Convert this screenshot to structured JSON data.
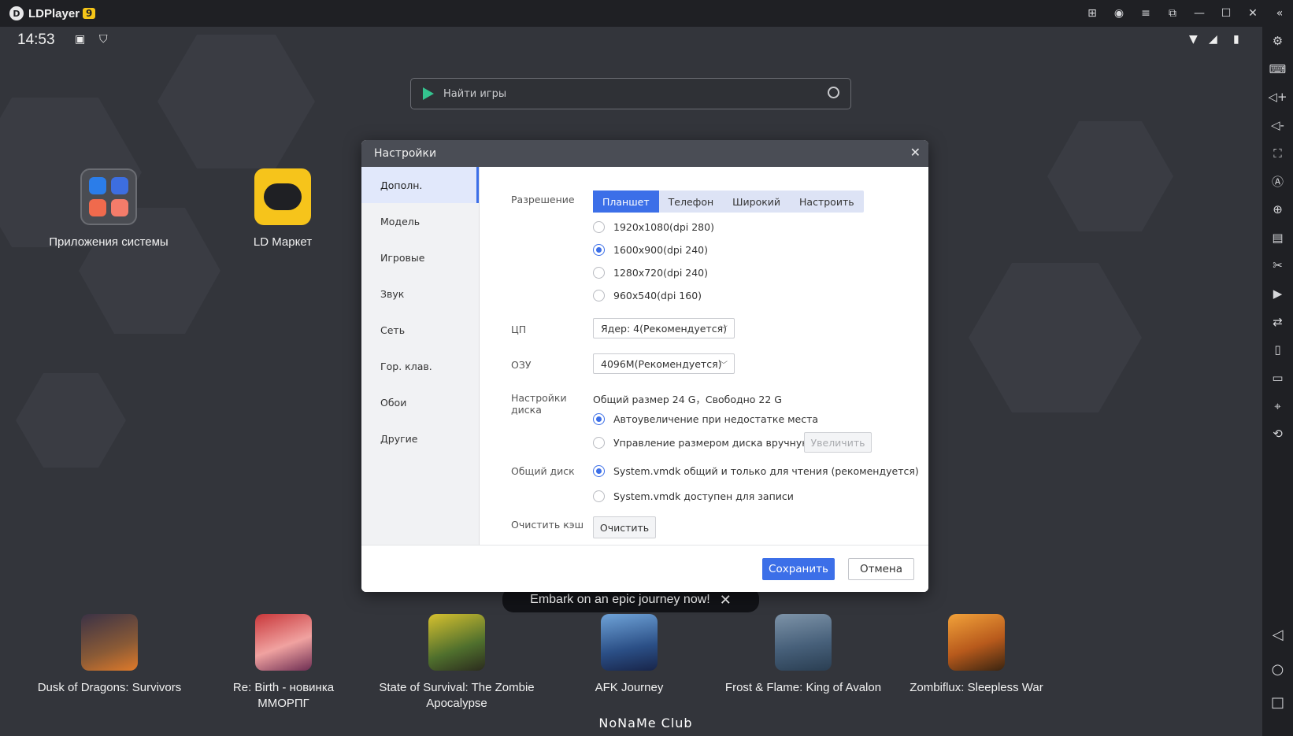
{
  "titlebar": {
    "app_name": "LDPlayer",
    "version_badge": "9"
  },
  "status": {
    "time": "14:53"
  },
  "search": {
    "placeholder": "Найти игры"
  },
  "desktop_apps": [
    {
      "label": "Приложения системы"
    },
    {
      "label": "LD Маркет"
    }
  ],
  "games": [
    {
      "label": "Dusk of Dragons: Survivors"
    },
    {
      "label": "Re: Birth - новинка ММОРПГ"
    },
    {
      "label": "State of Survival: The Zombie Apocalypse"
    },
    {
      "label": "AFK Journey"
    },
    {
      "label": "Frost & Flame: King of Avalon"
    },
    {
      "label": "Zombiflux: Sleepless War"
    }
  ],
  "banner": {
    "text": "Embark on an epic journey now!"
  },
  "watermark": "NoNaMe Club",
  "dialog": {
    "title": "Настройки",
    "sidebar": [
      {
        "label": "Дополн.",
        "active": true
      },
      {
        "label": "Модель"
      },
      {
        "label": "Игровые"
      },
      {
        "label": "Звук"
      },
      {
        "label": "Сеть"
      },
      {
        "label": "Гор. клав."
      },
      {
        "label": "Обои"
      },
      {
        "label": "Другие"
      }
    ],
    "resolution": {
      "label": "Разрешение",
      "tabs": [
        "Планшет",
        "Телефон",
        "Широкий",
        "Настроить"
      ],
      "active_tab": "Планшет",
      "options": [
        "1920x1080(dpi 280)",
        "1600x900(dpi 240)",
        "1280x720(dpi 240)",
        "960x540(dpi 160)"
      ],
      "selected": "1600x900(dpi 240)"
    },
    "cpu": {
      "label": "ЦП",
      "value": "Ядер: 4(Рекомендуется)"
    },
    "ram": {
      "label": "ОЗУ",
      "value": "4096M(Рекомендуется)"
    },
    "disk": {
      "label": "Настройки диска",
      "info": "Общий размер 24 G，Свободно 22 G",
      "options": [
        "Автоувеличение при недостатке места",
        "Управление размером диска вручную"
      ],
      "selected": "Автоувеличение при недостатке места",
      "increase_button": "Увеличить"
    },
    "shared_disk": {
      "label": "Общий диск",
      "options": [
        "System.vmdk общий и только для чтения (рекомендуется)",
        "System.vmdk доступен для записи"
      ],
      "selected": "System.vmdk общий и только для чтения (рекомендуется)"
    },
    "cache": {
      "label": "Очистить кэш",
      "button": "Очистить"
    },
    "footer": {
      "save": "Сохранить",
      "cancel": "Отмена"
    }
  },
  "colors": {
    "accent": "#3c6fe8",
    "titlebar_bg": "#1f2024",
    "desktop_bg": "#33353b"
  }
}
